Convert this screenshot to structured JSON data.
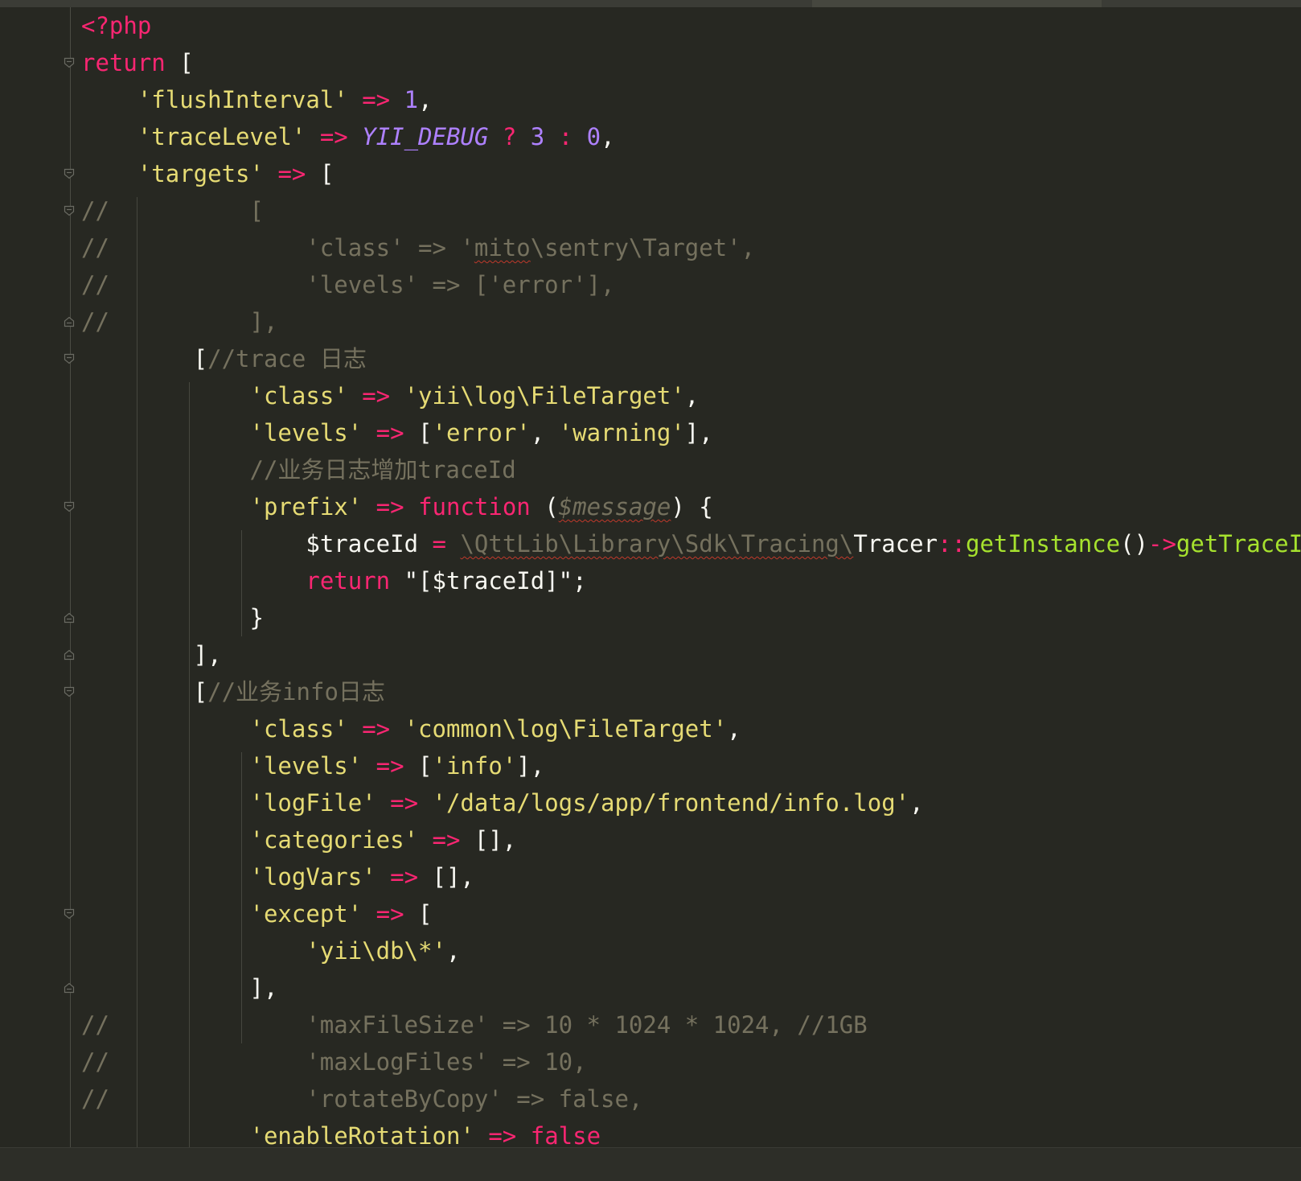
{
  "editor": {
    "language": "php",
    "theme_colors": {
      "background": "#272822",
      "keyword": "#f92672",
      "string": "#e6db74",
      "number": "#ae81ff",
      "comment": "#75715e",
      "function": "#a6e22e",
      "text": "#f8f8f2"
    },
    "lines": [
      {
        "fold": "none",
        "tokens": [
          {
            "t": "<?php",
            "c": "kw"
          }
        ]
      },
      {
        "fold": "open",
        "tokens": [
          {
            "t": "return",
            "c": "kw"
          },
          {
            "t": " [",
            "c": "plain"
          }
        ]
      },
      {
        "fold": "none",
        "tokens": [
          {
            "t": "    ",
            "c": "ws"
          },
          {
            "t": "'flushInterval'",
            "c": "str"
          },
          {
            "t": " ",
            "c": "ws"
          },
          {
            "t": "=>",
            "c": "kw"
          },
          {
            "t": " ",
            "c": "ws"
          },
          {
            "t": "1",
            "c": "num"
          },
          {
            "t": ",",
            "c": "plain"
          }
        ]
      },
      {
        "fold": "none",
        "tokens": [
          {
            "t": "    ",
            "c": "ws"
          },
          {
            "t": "'traceLevel'",
            "c": "str"
          },
          {
            "t": " ",
            "c": "ws"
          },
          {
            "t": "=>",
            "c": "kw"
          },
          {
            "t": " ",
            "c": "ws"
          },
          {
            "t": "YII_DEBUG",
            "c": "const"
          },
          {
            "t": " ",
            "c": "ws"
          },
          {
            "t": "?",
            "c": "kw"
          },
          {
            "t": " ",
            "c": "ws"
          },
          {
            "t": "3",
            "c": "num"
          },
          {
            "t": " ",
            "c": "ws"
          },
          {
            "t": ":",
            "c": "kw"
          },
          {
            "t": " ",
            "c": "ws"
          },
          {
            "t": "0",
            "c": "num"
          },
          {
            "t": ",",
            "c": "plain"
          }
        ]
      },
      {
        "fold": "open",
        "tokens": [
          {
            "t": "    ",
            "c": "ws"
          },
          {
            "t": "'targets'",
            "c": "str"
          },
          {
            "t": " ",
            "c": "ws"
          },
          {
            "t": "=>",
            "c": "kw"
          },
          {
            "t": " [",
            "c": "plain"
          }
        ]
      },
      {
        "fold": "open",
        "tokens": [
          {
            "t": "//          [",
            "c": "cmt"
          }
        ]
      },
      {
        "fold": "none",
        "tokens": [
          {
            "t": "//              'class' => '",
            "c": "cmt"
          },
          {
            "t": "mito",
            "c": "cmt squig"
          },
          {
            "t": "\\sentry\\Target',",
            "c": "cmt"
          }
        ]
      },
      {
        "fold": "none",
        "tokens": [
          {
            "t": "//              'levels' => ['error'],",
            "c": "cmt"
          }
        ]
      },
      {
        "fold": "close",
        "tokens": [
          {
            "t": "//          ],",
            "c": "cmt"
          }
        ]
      },
      {
        "fold": "open",
        "tokens": [
          {
            "t": "        [",
            "c": "plain"
          },
          {
            "t": "//trace 日志",
            "c": "cmt"
          }
        ]
      },
      {
        "fold": "none",
        "tokens": [
          {
            "t": "            ",
            "c": "ws"
          },
          {
            "t": "'class'",
            "c": "str"
          },
          {
            "t": " ",
            "c": "ws"
          },
          {
            "t": "=>",
            "c": "kw"
          },
          {
            "t": " ",
            "c": "ws"
          },
          {
            "t": "'yii\\log\\FileTarget'",
            "c": "str"
          },
          {
            "t": ",",
            "c": "plain"
          }
        ]
      },
      {
        "fold": "none",
        "tokens": [
          {
            "t": "            ",
            "c": "ws"
          },
          {
            "t": "'levels'",
            "c": "str"
          },
          {
            "t": " ",
            "c": "ws"
          },
          {
            "t": "=>",
            "c": "kw"
          },
          {
            "t": " [",
            "c": "plain"
          },
          {
            "t": "'error'",
            "c": "str"
          },
          {
            "t": ", ",
            "c": "plain"
          },
          {
            "t": "'warning'",
            "c": "str"
          },
          {
            "t": "],",
            "c": "plain"
          }
        ]
      },
      {
        "fold": "none",
        "tokens": [
          {
            "t": "            ",
            "c": "ws"
          },
          {
            "t": "//业务日志增加traceId",
            "c": "cmt"
          }
        ]
      },
      {
        "fold": "open",
        "tokens": [
          {
            "t": "            ",
            "c": "ws"
          },
          {
            "t": "'prefix'",
            "c": "str"
          },
          {
            "t": " ",
            "c": "ws"
          },
          {
            "t": "=>",
            "c": "kw"
          },
          {
            "t": " ",
            "c": "ws"
          },
          {
            "t": "function",
            "c": "kw"
          },
          {
            "t": " (",
            "c": "plain"
          },
          {
            "t": "$message",
            "c": "param squig"
          },
          {
            "t": ") {",
            "c": "plain"
          }
        ]
      },
      {
        "fold": "none",
        "tokens": [
          {
            "t": "                ",
            "c": "ws"
          },
          {
            "t": "$traceId",
            "c": "var"
          },
          {
            "t": " ",
            "c": "ws"
          },
          {
            "t": "=",
            "c": "kw"
          },
          {
            "t": " ",
            "c": "ws"
          },
          {
            "t": "\\QttLib\\Library\\Sdk\\Tracing\\",
            "c": "dimplain squig"
          },
          {
            "t": "Tracer",
            "c": "plain"
          },
          {
            "t": "::",
            "c": "kw"
          },
          {
            "t": "getInstance",
            "c": "fn"
          },
          {
            "t": "()",
            "c": "plain"
          },
          {
            "t": "->",
            "c": "kw"
          },
          {
            "t": "getTraceId",
            "c": "fn"
          },
          {
            "t": "();",
            "c": "plain"
          }
        ]
      },
      {
        "fold": "none",
        "tokens": [
          {
            "t": "                ",
            "c": "ws"
          },
          {
            "t": "return",
            "c": "kw"
          },
          {
            "t": " ",
            "c": "ws"
          },
          {
            "t": "\"[$traceId]\"",
            "c": "plain"
          },
          {
            "t": ";",
            "c": "plain"
          }
        ]
      },
      {
        "fold": "close",
        "tokens": [
          {
            "t": "            }",
            "c": "plain"
          }
        ]
      },
      {
        "fold": "close",
        "tokens": [
          {
            "t": "        ],",
            "c": "plain"
          }
        ]
      },
      {
        "fold": "open",
        "tokens": [
          {
            "t": "        [",
            "c": "plain"
          },
          {
            "t": "//业务info日志",
            "c": "cmt"
          }
        ]
      },
      {
        "fold": "none",
        "tokens": [
          {
            "t": "            ",
            "c": "ws"
          },
          {
            "t": "'class'",
            "c": "str"
          },
          {
            "t": " ",
            "c": "ws"
          },
          {
            "t": "=>",
            "c": "kw"
          },
          {
            "t": " ",
            "c": "ws"
          },
          {
            "t": "'common\\log\\FileTarget'",
            "c": "str"
          },
          {
            "t": ",",
            "c": "plain"
          }
        ]
      },
      {
        "fold": "none",
        "tokens": [
          {
            "t": "            ",
            "c": "ws"
          },
          {
            "t": "'levels'",
            "c": "str"
          },
          {
            "t": " ",
            "c": "ws"
          },
          {
            "t": "=>",
            "c": "kw"
          },
          {
            "t": " [",
            "c": "plain"
          },
          {
            "t": "'info'",
            "c": "str"
          },
          {
            "t": "],",
            "c": "plain"
          }
        ]
      },
      {
        "fold": "none",
        "tokens": [
          {
            "t": "            ",
            "c": "ws"
          },
          {
            "t": "'logFile'",
            "c": "str"
          },
          {
            "t": " ",
            "c": "ws"
          },
          {
            "t": "=>",
            "c": "kw"
          },
          {
            "t": " ",
            "c": "ws"
          },
          {
            "t": "'/data/logs/app/frontend/info.log'",
            "c": "str"
          },
          {
            "t": ",",
            "c": "plain"
          }
        ]
      },
      {
        "fold": "none",
        "tokens": [
          {
            "t": "            ",
            "c": "ws"
          },
          {
            "t": "'categories'",
            "c": "str"
          },
          {
            "t": " ",
            "c": "ws"
          },
          {
            "t": "=>",
            "c": "kw"
          },
          {
            "t": " [],",
            "c": "plain"
          }
        ]
      },
      {
        "fold": "none",
        "tokens": [
          {
            "t": "            ",
            "c": "ws"
          },
          {
            "t": "'logVars'",
            "c": "str"
          },
          {
            "t": " ",
            "c": "ws"
          },
          {
            "t": "=>",
            "c": "kw"
          },
          {
            "t": " [],",
            "c": "plain"
          }
        ]
      },
      {
        "fold": "open",
        "tokens": [
          {
            "t": "            ",
            "c": "ws"
          },
          {
            "t": "'except'",
            "c": "str"
          },
          {
            "t": " ",
            "c": "ws"
          },
          {
            "t": "=>",
            "c": "kw"
          },
          {
            "t": " [",
            "c": "plain"
          }
        ]
      },
      {
        "fold": "none",
        "tokens": [
          {
            "t": "                ",
            "c": "ws"
          },
          {
            "t": "'yii\\db\\*'",
            "c": "str"
          },
          {
            "t": ",",
            "c": "plain"
          }
        ]
      },
      {
        "fold": "close",
        "tokens": [
          {
            "t": "            ],",
            "c": "plain"
          }
        ]
      },
      {
        "fold": "none",
        "tokens": [
          {
            "t": "//              'maxFileSize' => 10 * 1024 * 1024, //1GB",
            "c": "cmt"
          }
        ]
      },
      {
        "fold": "none",
        "tokens": [
          {
            "t": "//              'maxLogFiles' => 10,",
            "c": "cmt"
          }
        ]
      },
      {
        "fold": "none",
        "tokens": [
          {
            "t": "//              'rotateByCopy' => false,",
            "c": "cmt"
          }
        ]
      },
      {
        "fold": "none",
        "tokens": [
          {
            "t": "            ",
            "c": "ws"
          },
          {
            "t": "'enableRotation'",
            "c": "str"
          },
          {
            "t": " ",
            "c": "ws"
          },
          {
            "t": "=>",
            "c": "kw"
          },
          {
            "t": " ",
            "c": "ws"
          },
          {
            "t": "false",
            "c": "kw"
          }
        ]
      }
    ]
  }
}
